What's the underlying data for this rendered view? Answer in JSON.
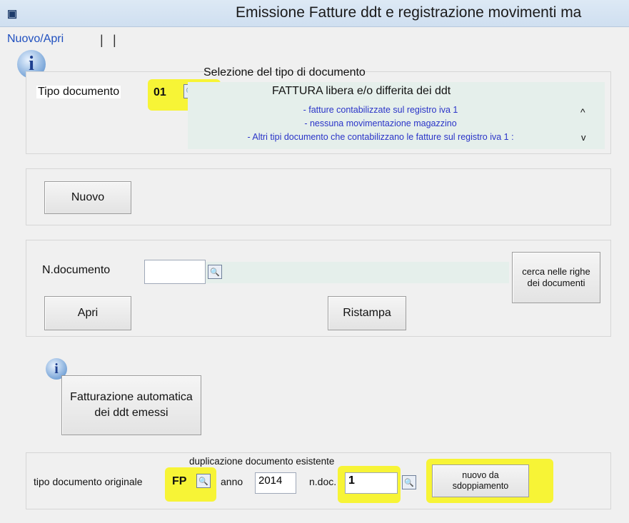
{
  "window": {
    "title": "Emissione Fatture ddt e registrazione movimenti ma",
    "app_icon": "app-icon"
  },
  "tabs": [
    {
      "label": "Nuovo/Apri",
      "active": true
    },
    {
      "label": "",
      "active": false
    },
    {
      "label": "",
      "active": false
    }
  ],
  "tipo_section": {
    "heading": "Selezione del tipo di documento",
    "label": "Tipo documento",
    "code": "01",
    "doc_title": "FATTURA libera e/o differita dei ddt",
    "desc_lines": [
      "- fatture contabilizzate sul registro iva 1",
      "- nessuna movimentazione magazzino",
      "- Altri tipi documento che contabilizzano le fatture sul registro iva 1 :"
    ],
    "scroll_up": "^",
    "scroll_down": "v"
  },
  "nuovo_button": "Nuovo",
  "doc_section": {
    "label": "N.documento",
    "value": "",
    "search_rows_button": "cerca nelle righe dei documenti",
    "apri_button": "Apri",
    "ristampa_button": "Ristampa"
  },
  "fatturazione_button": "Fatturazione automatica dei ddt emessi",
  "dup_section": {
    "heading": "duplicazione documento esistente",
    "tipo_label": "tipo documento originale",
    "tipo_value": "FP",
    "anno_label": "anno",
    "anno_value": "2014",
    "ndoc_label": "n.doc.",
    "ndoc_value": "1",
    "split_button": "nuovo da sdoppiamento"
  },
  "colors": {
    "highlight": "#f7f436",
    "link_blue": "#2a34c8",
    "tab_blue": "#1f4fbf"
  }
}
